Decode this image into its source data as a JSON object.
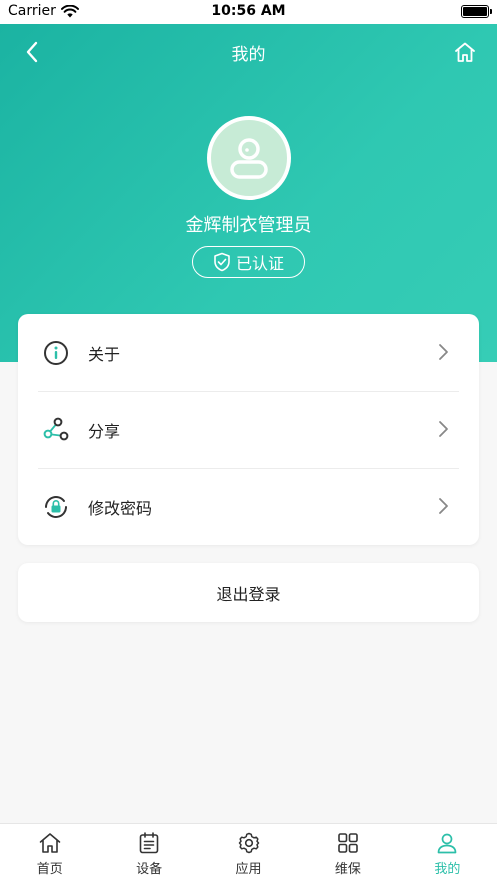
{
  "status_bar": {
    "carrier": "Carrier",
    "time": "10:56 AM"
  },
  "nav": {
    "title": "我的"
  },
  "profile": {
    "name": "金辉制衣管理员",
    "badge": "已认证"
  },
  "menu": [
    {
      "label": "关于",
      "icon": "info-icon"
    },
    {
      "label": "分享",
      "icon": "share-icon"
    },
    {
      "label": "修改密码",
      "icon": "lock-icon"
    }
  ],
  "logout_label": "退出登录",
  "tabbar": [
    {
      "label": "首页",
      "icon": "home-icon",
      "active": false
    },
    {
      "label": "设备",
      "icon": "clipboard-icon",
      "active": false
    },
    {
      "label": "应用",
      "icon": "gear-icon",
      "active": false
    },
    {
      "label": "维保",
      "icon": "grid-icon",
      "active": false
    },
    {
      "label": "我的",
      "icon": "user-icon",
      "active": true
    }
  ],
  "colors": {
    "accent": "#2cbfa9",
    "header_start": "#1bb3a2",
    "header_end": "#36cdb6"
  }
}
